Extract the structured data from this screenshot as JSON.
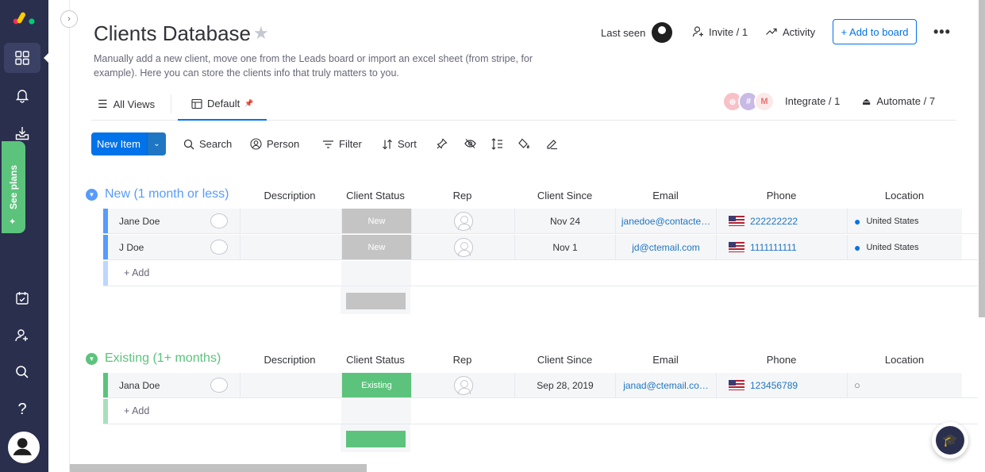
{
  "rail": {
    "see_plans": "See plans",
    "icons": [
      "logo",
      "home-grid-icon",
      "bell-icon",
      "inbox-download-icon",
      "calendar-check-icon",
      "add-user-icon",
      "search-icon",
      "help-icon",
      "user-avatar-icon"
    ]
  },
  "board": {
    "title": "Clients Database",
    "description": "Manually add a new client, move one from the Leads board or import an excel sheet (from stripe, for example). Here you can store the clients info that truly matters to you."
  },
  "header": {
    "last_seen": "Last seen",
    "invite": "Invite / 1",
    "activity": "Activity",
    "add_to_board": "+ Add to board",
    "more": "•••"
  },
  "tabs": {
    "all_views": "All Views",
    "default": "Default",
    "integrate": "Integrate / 1",
    "automate": "Automate / 7"
  },
  "toolbar": {
    "new_item": "New Item",
    "search": "Search",
    "person": "Person",
    "filter": "Filter",
    "sort": "Sort"
  },
  "columns": [
    "Description",
    "Client Status",
    "Rep",
    "Client Since",
    "Email",
    "Phone",
    "Location"
  ],
  "colors": {
    "brand_blue": "#0073ea",
    "new_group": "#579bfc",
    "existing_group": "#5cc37c",
    "status_new": "#c4c4c4",
    "status_existing": "#5cc37c",
    "rail_bg": "#292f4c"
  },
  "groups": [
    {
      "title": "New (1 month or less)",
      "rows": [
        {
          "name": "Jane Doe",
          "status": "New",
          "client_since": "Nov 24",
          "email": "janedoe@contacte…",
          "phone": "222222222",
          "location": "United States"
        },
        {
          "name": "J Doe",
          "status": "New",
          "client_since": "Nov 1",
          "email": "jd@ctemail.com",
          "phone": "1111111111",
          "location": "United States"
        }
      ],
      "add_label": "+ Add"
    },
    {
      "title": "Existing (1+ months)",
      "rows": [
        {
          "name": "Jana Doe",
          "status": "Existing",
          "client_since": "Sep 28, 2019",
          "email": "janad@ctemail.co…",
          "phone": "123456789",
          "location": ""
        }
      ],
      "add_label": "+ Add"
    }
  ]
}
